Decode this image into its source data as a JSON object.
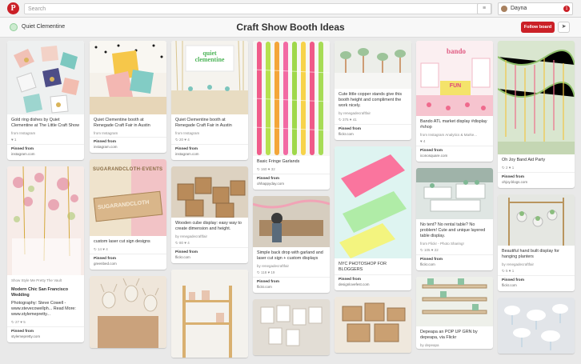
{
  "topbar": {
    "logo": "P",
    "search_placeholder": "Search",
    "menu_icon": "≡",
    "user_name": "Dayna",
    "notifications": "1"
  },
  "board": {
    "owner": "Quiet Clementine",
    "title": "Craft Show Booth Ideas",
    "follow_label": "Follow board",
    "send_icon": "➤"
  },
  "pins": {
    "c1p1": {
      "caption": "Gold ring dishes by Quiet Clementine at The Little Craft Show",
      "via": "from Instagram",
      "stats": "♥ 1",
      "pinned_from": "Pinned from",
      "source": "instagram.com"
    },
    "c1p2": {
      "via": "Show Style Me Pretty The Vault",
      "caption": "Modern Chic San Francisco Wedding",
      "desc": "Photography: Steve Cowell - www.stevecowellph... Read More: www.stylemepretty...",
      "stats": "↻ 27  ♥ 5",
      "pinned_from": "Pinned from",
      "source": "stylemepretty.com"
    },
    "c2p1": {
      "caption": "Quiet Clementine booth at Renegade Craft Fair in Austin",
      "via": "from Instagram",
      "pinned_from": "Pinned from",
      "source": "instagram.com"
    },
    "c2p2": {
      "sign1": "SUGARANDCLOTH",
      "sign2": "EVENTS",
      "caption": "custom laser cut sign designs",
      "stats": "↻ 14  ♥ 4",
      "pinned_from": "Pinned from",
      "source": "greenbed.com"
    },
    "c3p1": {
      "sign": "quiet clementine",
      "caption": "Quiet Clementine booth at Renegade Craft Fair in Austin",
      "via": "from Instagram",
      "stats": "↻ 20  ♥ 4",
      "pinned_from": "Pinned from",
      "source": "instagram.com"
    },
    "c3p2": {
      "caption": "Wooden cube display: easy way to create dimension and height.",
      "via": "by renegadecraftfair",
      "stats": "↻ 80  ♥ 4",
      "pinned_from": "Pinned from",
      "source": "flickr.com"
    },
    "c4p1": {
      "caption": "Basic Fringe Garlands",
      "stats": "↻ 160  ♥ 32",
      "pinned_from": "Pinned from",
      "source": "ohhappyday.com"
    },
    "c4p2": {
      "caption": "Simple back drop with garland and laser cut sign + custom displays",
      "via": "by renegadecraftfair",
      "stats": "↻ 118  ♥ 19",
      "pinned_from": "Pinned from",
      "source": "flickr.com"
    },
    "c5p1": {
      "caption": "Cute little copper stands give this booth height and compliment the work nicely.",
      "via": "by renegadecraftfair",
      "stats": "↻ 375  ♥ 41",
      "pinned_from": "Pinned from",
      "source": "flickr.com"
    },
    "c5p2": {
      "caption": "NYC PHOTOSHOP FOR BLOGGERS",
      "pinned_from": "Pinned from",
      "source": "designlovefest.com"
    },
    "c6p1": {
      "sign1": "bando",
      "sign2": "FUN",
      "caption": "Bando ATL market display #display #shop",
      "via": "from Instagram Analytics & Marke...",
      "stats": "♥ 4",
      "pinned_from": "Pinned from",
      "source": "iconosquare.com"
    },
    "c6p2": {
      "caption": "No tent? No rental table? No problem! Cute and unique layered table display.",
      "via": "from Flickr - Photo Sharing!",
      "stats": "↻ 105  ♥ 22",
      "pinned_from": "Pinned from",
      "source": "flickr.com"
    },
    "c6p3": {
      "caption": "Depeapa an POP UP GRN by depeapa, via Flickr",
      "via": "by depeapa"
    },
    "c7p1": {
      "caption": "Oh Joy Band Aid Party",
      "stats": "↻ 2  ♥ 1",
      "pinned_from": "Pinned from",
      "source": "ohjoy.blogs.com"
    },
    "c7p2": {
      "caption": "Beautiful hand built display for hanging planters",
      "via": "by renegadecraftfair",
      "stats": "↻ 5  ♥ 1",
      "pinned_from": "Pinned from",
      "source": "flickr.com"
    }
  }
}
